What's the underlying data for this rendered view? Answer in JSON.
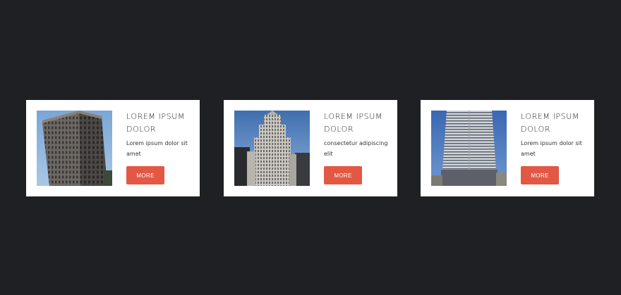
{
  "colors": {
    "page_background": "#1f2023",
    "card_background": "#ffffff",
    "button": "#e35843",
    "button_text": "#ffffff"
  },
  "cards": [
    {
      "image": "building-photo-brick-tower",
      "title": "LOREM IPSUM DOLOR",
      "description": "Lorem ipsum dolor sit amet",
      "button_label": "MORE"
    },
    {
      "image": "building-photo-art-deco-skyscraper",
      "title": "LOREM IPSUM DOLOR",
      "description": "consectetur adipiscing elit",
      "button_label": "MORE"
    },
    {
      "image": "building-photo-modern-tower",
      "title": "LOREM IPSUM DOLOR",
      "description": "Lorem ipsum dolor sit amet",
      "button_label": "MORE"
    }
  ]
}
